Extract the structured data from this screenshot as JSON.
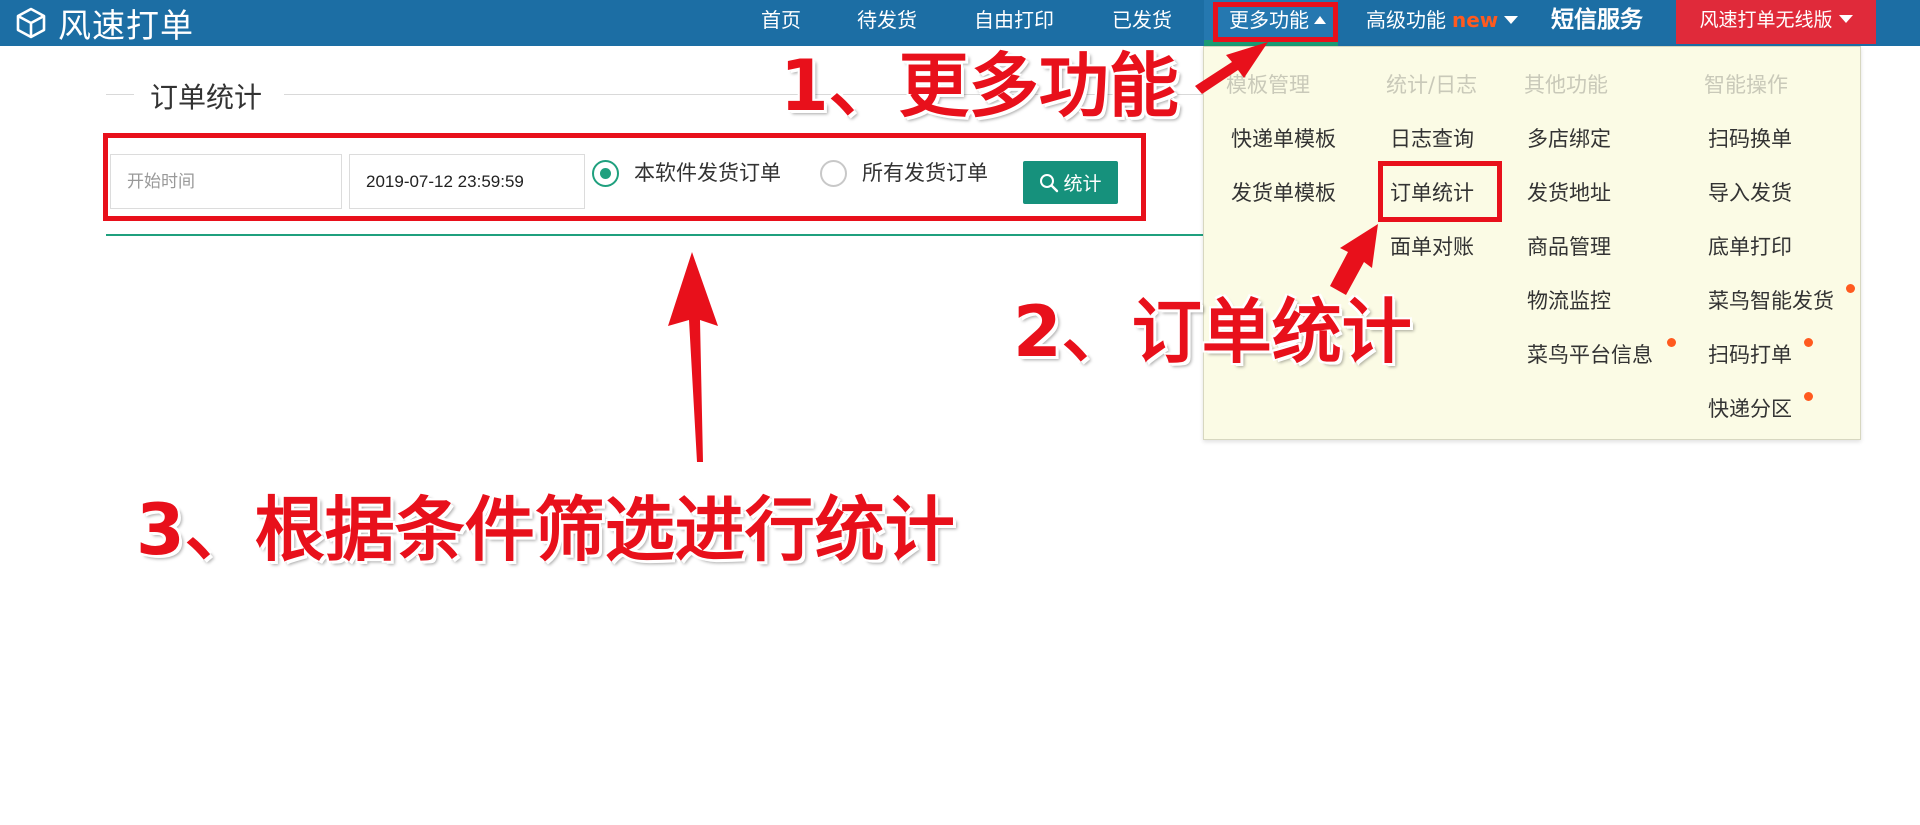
{
  "app": {
    "name": "风速打单"
  },
  "nav": {
    "home": "首页",
    "pending": "待发货",
    "free_print": "自由打印",
    "shipped": "已发货",
    "more": "更多功能",
    "advanced": "高级功能",
    "advanced_badge": "new",
    "sms": "短信服务",
    "wireless": "风速打单无线版"
  },
  "page": {
    "title": "订单统计",
    "start_placeholder": "开始时间",
    "end_value": "2019-07-12 23:59:59",
    "radio_this": "本软件发货订单",
    "radio_all": "所有发货订单",
    "radio_selected": "本软件发货订单",
    "stat_button": "统计"
  },
  "dropdown": {
    "columns": [
      {
        "header": "模板管理",
        "items": [
          "快递单模板",
          "发货单模板"
        ]
      },
      {
        "header": "统计/日志",
        "items": [
          "日志查询",
          "订单统计",
          "面单对账"
        ]
      },
      {
        "header": "其他功能",
        "items": [
          "多店绑定",
          "发货地址",
          "商品管理",
          "物流监控",
          "菜鸟平台信息"
        ]
      },
      {
        "header": "智能操作",
        "items": [
          "扫码换单",
          "导入发货",
          "底单打印",
          "菜鸟智能发货",
          "扫码打单",
          "快递分区"
        ]
      }
    ],
    "new_dot_items": [
      "菜鸟平台信息",
      "菜鸟智能发货",
      "扫码打单",
      "快递分区"
    ]
  },
  "annotations": {
    "step1": "1、更多功能",
    "step2": "2、订单统计",
    "step3": "3、根据条件筛选进行统计"
  },
  "colors": {
    "topbar": "#1c6ea4",
    "wireless": "#e02a3a",
    "accent": "#16917c",
    "dropdown_bg": "#fbfbe5",
    "annotation": "#e8101b",
    "badge": "#ff5a1f"
  }
}
